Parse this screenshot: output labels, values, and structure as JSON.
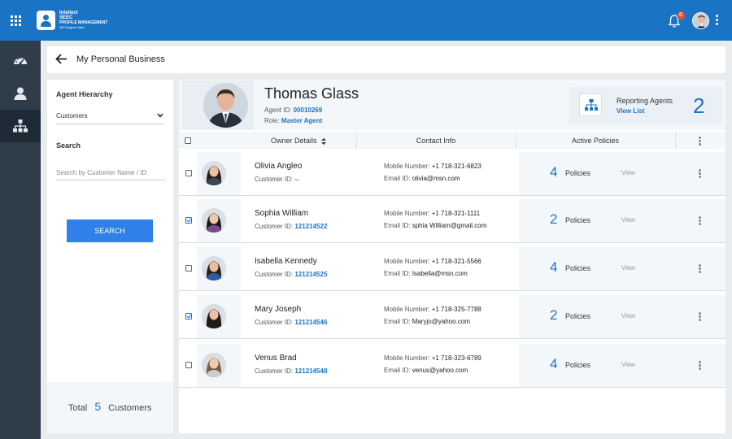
{
  "app": {
    "logo_line1": "Intellect",
    "logo_line2": "SEEC",
    "logo_line3": "PROFILE MANAGEMENT",
    "logo_line4": "360 Degree View",
    "notification_count": "6"
  },
  "header": {
    "title": "My Personal Business"
  },
  "left_panel": {
    "hierarchy_label": "Agent Hierarchy",
    "hierarchy_value": "Customers",
    "search_label": "Search",
    "search_placeholder": "Search by Customer Name / ID",
    "search_button": "SEARCH",
    "total_prefix": "Total",
    "total_count": "5",
    "total_suffix": "Customers"
  },
  "profile": {
    "name": "Thomas Glass",
    "agent_id_label": "Agent ID:",
    "agent_id": "00010269",
    "role_label": "Role:",
    "role": "Master Agent",
    "reporting_label": "Reporting Agents",
    "reporting_link": "View List",
    "reporting_count": "2"
  },
  "table": {
    "headers": [
      "Owner Details",
      "Contact Info",
      "Active Policies"
    ],
    "rows": [
      {
        "name": "Olivia Angleo",
        "cid_label": "Customer ID:",
        "cid": "--",
        "mob_label": "Mobile Number:",
        "mobile": "+1 718-321-6823",
        "email_label": "Email ID:",
        "email": "olivia@msn.com",
        "count": "4",
        "policies": "Policies",
        "view": "View",
        "checked": false
      },
      {
        "name": "Sophia William",
        "cid_label": "Customer ID:",
        "cid": "121214522",
        "mob_label": "Mobile Number:",
        "mobile": "+1 718-321-1111",
        "email_label": "Email ID:",
        "email": "sphia William@gmail.com",
        "count": "2",
        "policies": "Policies",
        "view": "View",
        "checked": true
      },
      {
        "name": "Isabella Kennedy",
        "cid_label": "Customer ID:",
        "cid": "121214525",
        "mob_label": "Mobile Number:",
        "mobile": "+1 718-321-5566",
        "email_label": "Email ID:",
        "email": "Isabella@msn.com",
        "count": "4",
        "policies": "Policies",
        "view": "View",
        "checked": false
      },
      {
        "name": "Mary Joseph",
        "cid_label": "Customer ID:",
        "cid": "121214546",
        "mob_label": "Mobile Number:",
        "mobile": "+1 718-325-7788",
        "email_label": "Email ID:",
        "email": "Maryjo@yahoo.com",
        "count": "2",
        "policies": "Policies",
        "view": "View",
        "checked": true
      },
      {
        "name": "Venus Brad",
        "cid_label": "Customer ID:",
        "cid": "121214548",
        "mob_label": "Mobile Number:",
        "mobile": "+1 718-323-6789",
        "email_label": "Email ID:",
        "email": "venus@yahoo.com",
        "count": "4",
        "policies": "Policies",
        "view": "View",
        "checked": false
      }
    ]
  },
  "colors": {
    "brand": "#1a74c6",
    "nav": "#2f3d4a",
    "button": "#2f80e8"
  },
  "icons": [
    "apps-grid-icon",
    "bell-icon",
    "more-vert-icon",
    "dashboard-icon",
    "user-icon",
    "hierarchy-icon",
    "back-arrow-icon",
    "chevron-down-icon",
    "sort-icon",
    "checkbox-icon"
  ]
}
